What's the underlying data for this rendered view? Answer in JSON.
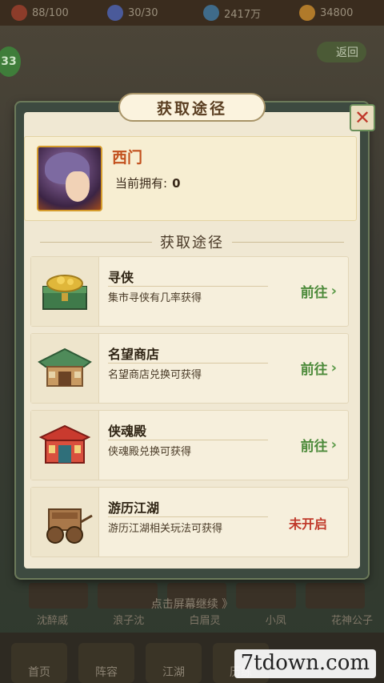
{
  "background": {
    "resources": [
      {
        "icon": "energy-icon",
        "value": "88/100",
        "color": "#8c3c2a"
      },
      {
        "icon": "stamina-icon",
        "value": "30/30",
        "color": "#4a5a9a"
      },
      {
        "icon": "gem-icon",
        "value": "2417万",
        "color": "#3f6b8a"
      },
      {
        "icon": "coin-icon",
        "value": "34800",
        "color": "#b07a2a"
      }
    ],
    "level": "33",
    "back_label": "返回",
    "tap_hint": "点击屏幕继续 》",
    "hero_names": [
      "沈醉威",
      "浪子沈",
      "白眉灵",
      "小凤",
      "花神公子"
    ],
    "nav": [
      "首页",
      "阵容",
      "江湖",
      "历练"
    ],
    "watermark": "7tdown.com"
  },
  "dialog": {
    "title": "获取途径",
    "close_label": "✕",
    "hero": {
      "name": "西门",
      "own_label": "当前拥有:",
      "own_count": "0"
    },
    "section_title": "获取途径",
    "routes": [
      {
        "name": "寻侠",
        "desc": "集市寻侠有几率获得",
        "action": "前往",
        "icon": "treasure-chest-icon",
        "available": true
      },
      {
        "name": "名望商店",
        "desc": "名望商店兑换可获得",
        "action": "前往",
        "icon": "shop-icon",
        "available": true
      },
      {
        "name": "侠魂殿",
        "desc": "侠魂殿兑换可获得",
        "action": "前往",
        "icon": "temple-icon",
        "available": true
      },
      {
        "name": "游历江湖",
        "desc": "游历江湖相关玩法可获得",
        "action": "未开启",
        "icon": "cart-icon",
        "available": false
      }
    ]
  },
  "colors": {
    "go": "#4c8a3a",
    "locked": "#c03a2b",
    "hero_name": "#c2501d"
  }
}
